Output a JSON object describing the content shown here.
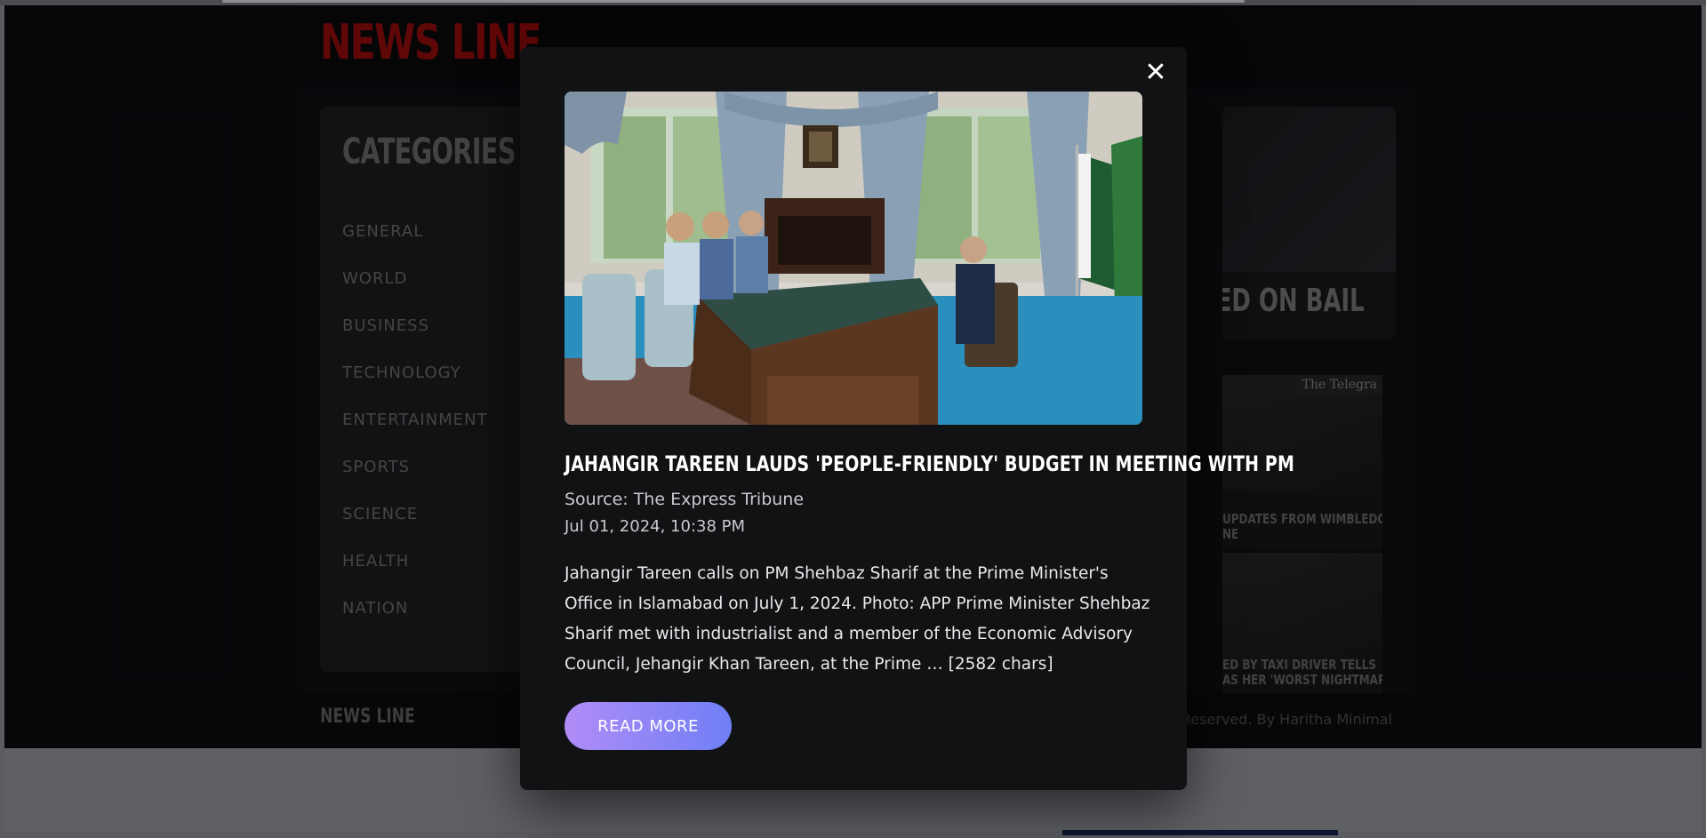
{
  "site": {
    "logo": "NEWS LINE",
    "footer_logo": "NEWS LINE",
    "footer_copy": "Reserved. By Haritha Minimal"
  },
  "sidebar": {
    "title": "CATEGORIES",
    "items": [
      {
        "label": "GENERAL"
      },
      {
        "label": "WORLD"
      },
      {
        "label": "BUSINESS"
      },
      {
        "label": "TECHNOLOGY"
      },
      {
        "label": "ENTERTAINMENT"
      },
      {
        "label": "SPORTS"
      },
      {
        "label": "SCIENCE"
      },
      {
        "label": "HEALTH"
      },
      {
        "label": "NATION"
      }
    ]
  },
  "background_cards": {
    "featured_caption": "EED ON BAIL",
    "card1": {
      "badge": "The Telegra",
      "caption": "UPDATES FROM WIMBLEDON\nNE"
    },
    "card2": {
      "caption": "ED BY TAXI DRIVER TELLS\nAS HER 'WORST NIGHTMARE'"
    }
  },
  "modal": {
    "close_label": "✕",
    "title": "JAHANGIR TAREEN LAUDS 'PEOPLE-FRIENDLY' BUDGET IN MEETING WITH PM",
    "source": "Source: The Express Tribune",
    "date": "Jul 01, 2024, 10:38 PM",
    "body": "Jahangir Tareen calls on PM Shehbaz Sharif at the Prime Minister's Office in Islamabad on July 1, 2024. Photo: APP Prime Minister Shehbaz Sharif met with industrialist and a member of the Economic Advisory Council, Jehangir Khan Tareen, at the Prime … [2582 chars]",
    "read_more_label": "READ MORE"
  },
  "colors": {
    "logo_red": "#b00d10",
    "button_gradient_start": "#b08cf7",
    "button_gradient_end": "#6f7ff5",
    "modal_bg": "#111214"
  }
}
